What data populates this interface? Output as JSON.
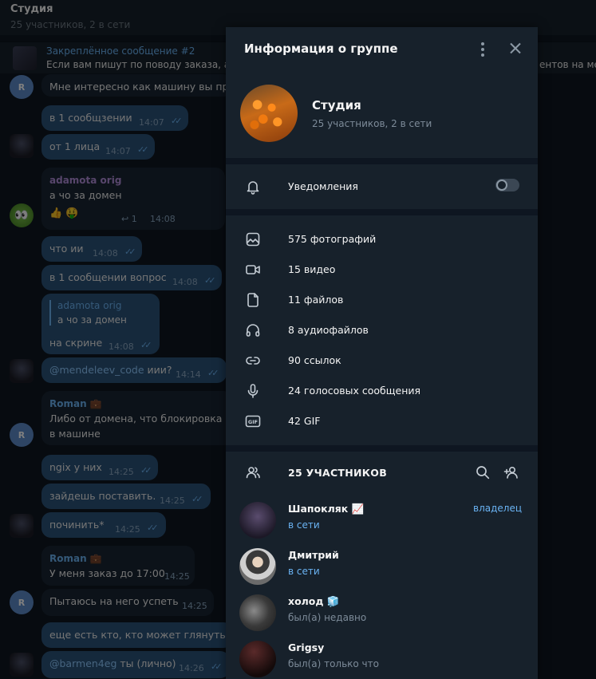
{
  "chat": {
    "title": "Студия",
    "status": "25 участников, 2 в сети",
    "pinned_title": "Закреплённое сообщение #2",
    "pinned_text": "Если вам пишут по поводу заказа, а",
    "pinned_tail": "ентов на ме",
    "messages": [
      {
        "text": "Мне интересно как машину вы про",
        "time": "",
        "avatar": "R"
      },
      {
        "text": "в 1 сообщзении",
        "time": "14:07"
      },
      {
        "text": "от 1 лица",
        "time": "14:07"
      },
      {
        "sender": "adamota orig",
        "text": "а чо за домен",
        "reactions": "👍 🤑",
        "replies": "1",
        "time": "14:08"
      },
      {
        "text": "что ии",
        "time": "14:08"
      },
      {
        "text": "в 1 сообщении вопрос",
        "time": "14:08"
      },
      {
        "quote_name": "adamota orig",
        "quote_text": "а чо за домен",
        "text": "на скрине",
        "time": "14:08"
      },
      {
        "mention": "@mendeleev_code",
        "text": " иии?",
        "time": "14:14"
      },
      {
        "sender": "Roman 💼",
        "text": "Либо от домена, что блокировка гд",
        "text2": "в машине",
        "avatar": "R"
      },
      {
        "text": "ngix у них",
        "time": "14:25"
      },
      {
        "text": "зайдешь поставить.",
        "time": "14:25"
      },
      {
        "text": "починить*",
        "time": "14:25"
      },
      {
        "sender": "Roman 💼",
        "text": "У меня заказ до 17:00",
        "time": "14:25"
      },
      {
        "text": "Пытаюсь на него успеть",
        "time": "14:25",
        "avatar": "R"
      },
      {
        "text": "еще есть кто, кто может глянуть?",
        "time": ""
      },
      {
        "mention": "@barmen4eg",
        "text": " ты (лично)",
        "time": "14:26"
      }
    ]
  },
  "panel": {
    "title": "Информация о группе",
    "group_name": "Студия",
    "group_sub": "25 участников, 2 в сети",
    "notifications_label": "Уведомления",
    "notifications_on": false,
    "media": [
      {
        "icon": "photo-icon",
        "label": "575 фотографий"
      },
      {
        "icon": "video-icon",
        "label": "15 видео"
      },
      {
        "icon": "file-icon",
        "label": "11 файлов"
      },
      {
        "icon": "headphones-icon",
        "label": "8 аудиофайлов"
      },
      {
        "icon": "link-icon",
        "label": "90 ссылок"
      },
      {
        "icon": "microphone-icon",
        "label": "24 голосовых сообщения"
      },
      {
        "icon": "gif-icon",
        "label": "42 GIF"
      }
    ],
    "members_title": "25 УЧАСТНИКОВ",
    "members": [
      {
        "name": "Шапокляк 📈",
        "status": "в сети",
        "online": true,
        "role": "владелец"
      },
      {
        "name": "Дмитрий",
        "status": "в сети",
        "online": true,
        "role": ""
      },
      {
        "name": "холод 🧊",
        "status": "был(а) недавно",
        "online": false,
        "role": ""
      },
      {
        "name": "Grigsy",
        "status": "был(а) только что",
        "online": false,
        "role": ""
      }
    ]
  },
  "colors": {
    "accent": "#6ab3f3",
    "panel_bg": "#17212b",
    "app_bg": "#0e1621"
  }
}
